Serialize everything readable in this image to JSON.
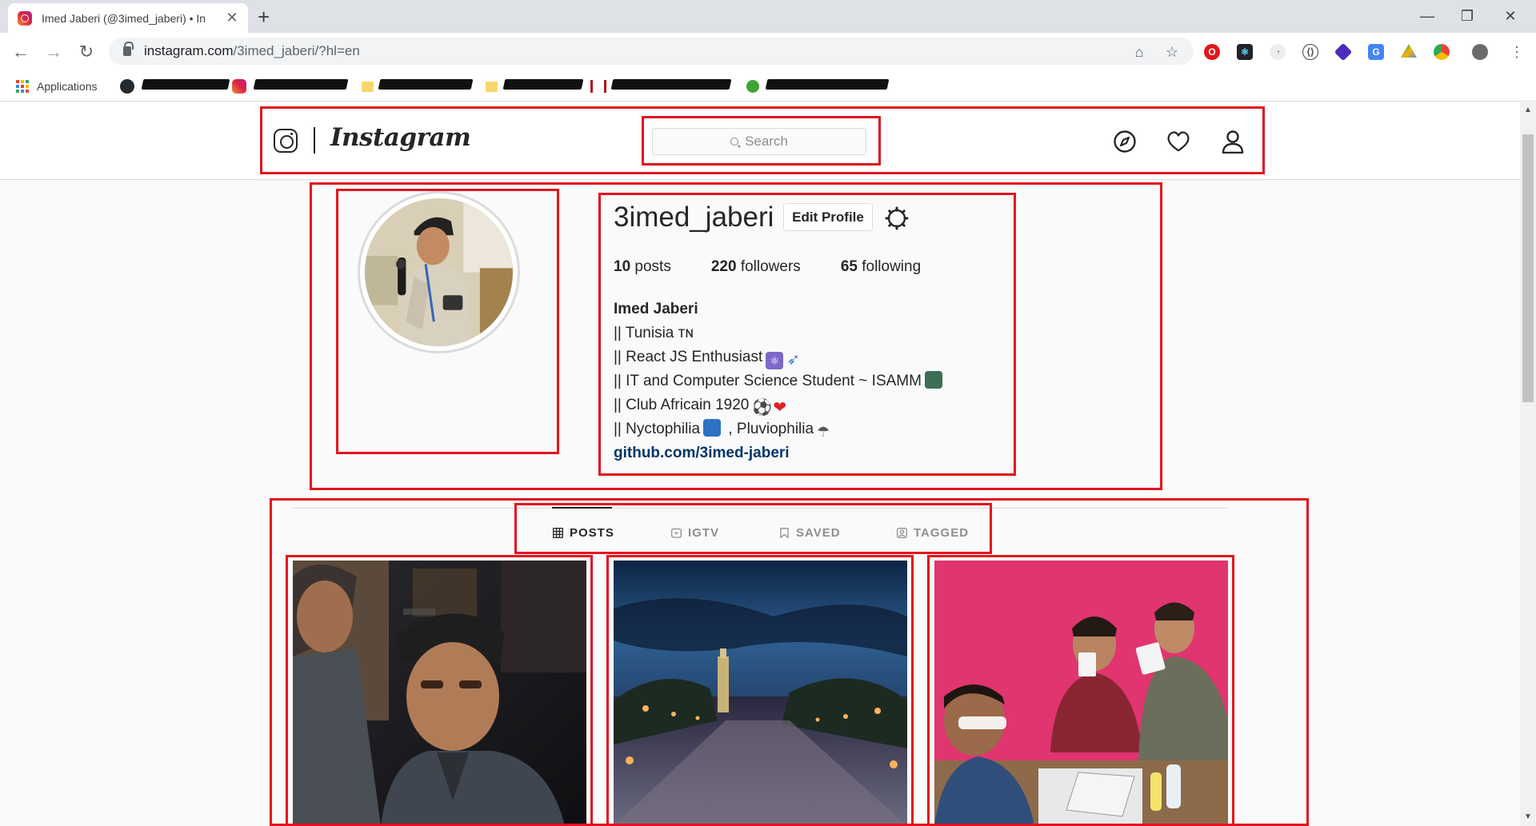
{
  "browser": {
    "tab_title": "Imed Jaberi (@3imed_jaberi) • In",
    "url_host": "instagram.com",
    "url_path": "/3imed_jaberi/?hl=en",
    "bookmarks_apps_label": "Applications",
    "icons": [
      "back-icon",
      "forward-icon",
      "reload-icon",
      "lock-icon",
      "translate-icon",
      "star-icon",
      "new-tab-icon",
      "close-icon",
      "minimize-icon",
      "maximize-icon"
    ]
  },
  "header": {
    "wordmark": "Instagram",
    "search_placeholder": "Search",
    "icons": [
      "explore-compass-icon",
      "activity-heart-icon",
      "profile-user-icon"
    ]
  },
  "profile": {
    "username": "3imed_jaberi",
    "edit_profile_label": "Edit Profile",
    "stats": {
      "posts_count": "10",
      "posts_label": "posts",
      "followers_count": "220",
      "followers_label": "followers",
      "following_count": "65",
      "following_label": "following"
    },
    "full_name": "Imed Jaberi",
    "bio_lines": [
      "|| Tunisia ᴛɴ",
      "|| React JS Enthusiast",
      "|| IT and Computer Science Student ~ ISAMM",
      "|| Club Africain 1920",
      "|| Nyctophilia",
      ", Pluviophilia"
    ],
    "website": "github.com/3imed-jaberi"
  },
  "tabs": [
    {
      "label": "POSTS",
      "active": true
    },
    {
      "label": "IGTV",
      "active": false
    },
    {
      "label": "SAVED",
      "active": false
    },
    {
      "label": "TAGGED",
      "active": false
    }
  ],
  "colors": {
    "annotation": "#e0141e",
    "link": "#003569",
    "text": "#262626",
    "muted": "#8e8e8e",
    "border": "#dbdbdb"
  }
}
